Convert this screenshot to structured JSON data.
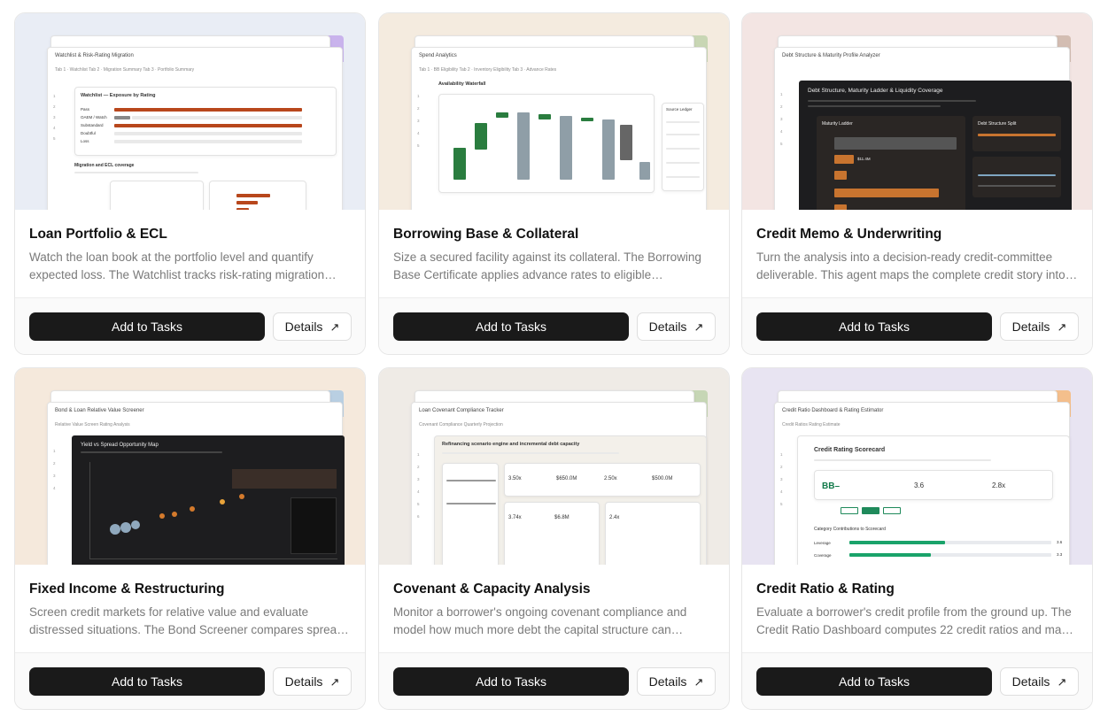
{
  "cards": [
    {
      "title": "Loan Portfolio & ECL",
      "description": "Watch the loan book at the portfolio level and quantify expected loss. The Watchlist tracks risk-rating migration across the portfolio.",
      "add_label": "Add to Tasks",
      "details_label": "Details",
      "preview": {
        "bg": "#e9edf5",
        "accent": "#c9b3ec",
        "window_title": "Watchlist & Risk-Rating Migration",
        "tabs": "Tab 1 · Watchlist    Tab 2 · Migration Summary    Tab 3 · Portfolio Summary",
        "heading": "Watchlist — Exposure by Rating",
        "sub_heading": "Migration and ECL coverage",
        "bars": [
          "Pass",
          "OAEM / Watch",
          "Substandard",
          "Doubtful",
          "Loss"
        ]
      }
    },
    {
      "title": "Borrowing Base & Collateral",
      "description": "Size a secured facility against its collateral. The Borrowing Base Certificate applies advance rates to eligible receivables and inventory.",
      "add_label": "Add to Tasks",
      "details_label": "Details",
      "preview": {
        "bg": "#f4ebdf",
        "accent": "#c8d6b4",
        "window_title": "Spend Analytics",
        "tabs": "Tab 1 · BB Eligibility    Tab 2 · Inventory Eligibility    Tab 3 · Advance Rates",
        "heading": "Availability Waterfall",
        "side_heading": "Source Ledger"
      }
    },
    {
      "title": "Credit Memo & Underwriting",
      "description": "Turn the analysis into a decision-ready credit-committee deliverable. This agent maps the complete credit story into a memo.",
      "add_label": "Add to Tasks",
      "details_label": "Details",
      "preview": {
        "bg": "#f3e5e3",
        "accent": "#d3bdb2",
        "window_title": "Debt Structure & Maturity Profile Analyzer",
        "heading": "Debt Structure, Maturity Ladder & Liquidity Coverage",
        "left_panel": "Maturity Ladder",
        "right_panel": "Debt Structure Split",
        "values": [
          "$11.4M",
          "$6.7M",
          "$18.0M",
          "$12.5M",
          "$14.0M"
        ]
      }
    },
    {
      "title": "Fixed Income & Restructuring",
      "description": "Screen credit markets for relative value and evaluate distressed situations. The Bond Screener compares spreads across issuers.",
      "add_label": "Add to Tasks",
      "details_label": "Details",
      "preview": {
        "bg": "#f5e9dc",
        "accent": "#b9cfe2",
        "window_title": "Bond & Loan Relative Value Screener",
        "tabs": "Relative Value Screen    Rating Analysis",
        "heading": "Yield vs Spread Opportunity Map"
      }
    },
    {
      "title": "Covenant & Capacity Analysis",
      "description": "Monitor a borrower's ongoing covenant compliance and model how much more debt the capital structure can support.",
      "add_label": "Add to Tasks",
      "details_label": "Details",
      "preview": {
        "bg": "#efebe6",
        "accent": "#c6d6b5",
        "window_title": "Loan Covenant Compliance Tracker",
        "tabs": "Covenant Compliance    Quarterly Projection",
        "heading": "Refinancing scenario engine and incremental debt capacity",
        "metrics": [
          "3.50x",
          "$650.0M",
          "2.50x",
          "$500.0M",
          "3.74x",
          "$6.8M",
          "2.4x"
        ]
      }
    },
    {
      "title": "Credit Ratio & Rating",
      "description": "Evaluate a borrower's credit profile from the ground up. The Credit Ratio Dashboard computes 22 credit ratios and maps them to a rating.",
      "add_label": "Add to Tasks",
      "details_label": "Details",
      "preview": {
        "bg": "#e8e4f2",
        "accent": "#f4bf8c",
        "window_title": "Credit Ratio Dashboard & Rating Estimator",
        "tabs": "Credit Ratios    Rating Estimate",
        "heading": "Credit Rating Scorecard",
        "rating": "BB–",
        "metric_a": "3.6",
        "metric_b": "2.8x",
        "section": "Category Contributions to Scorecard",
        "rows": [
          "Leverage",
          "Coverage"
        ],
        "row_vals": [
          "3.6",
          "3.3"
        ]
      }
    }
  ]
}
